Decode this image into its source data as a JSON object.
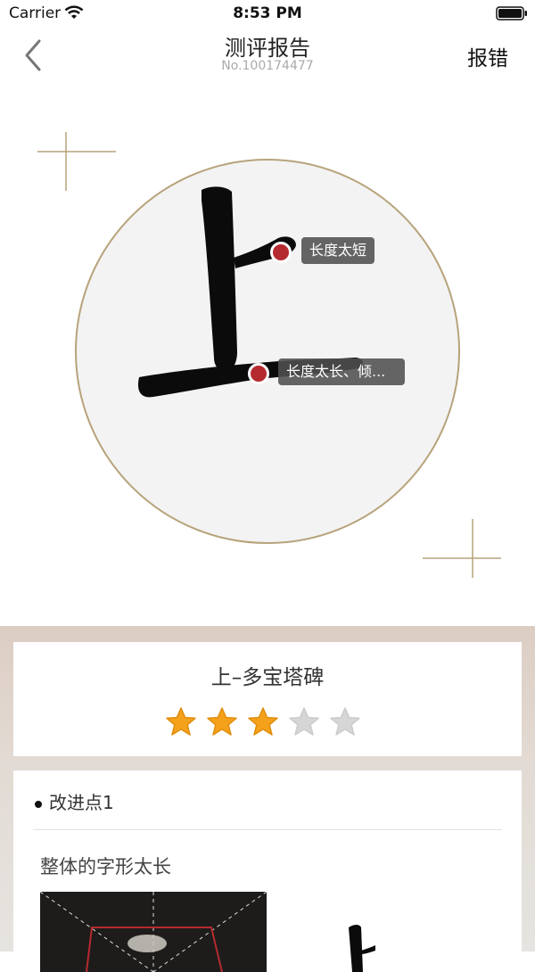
{
  "status_bar": {
    "carrier": "Carrier",
    "time": "8:53 PM"
  },
  "nav": {
    "title": "测评报告",
    "subtitle": "No.100174477",
    "report_error": "报错"
  },
  "annotations": [
    {
      "text": "长度太短"
    },
    {
      "text": "长度太长、倾..."
    }
  ],
  "result": {
    "character_title": "上–多宝塔碑",
    "rating": 3,
    "max_rating": 5
  },
  "improvement": {
    "label": "改进点1",
    "advice": "整体的字形太长"
  },
  "colors": {
    "accent_gold": "#b7a37b",
    "marker_red": "#b52a2f",
    "star_on": "#f4a21c",
    "star_off": "#d0d0d0"
  }
}
